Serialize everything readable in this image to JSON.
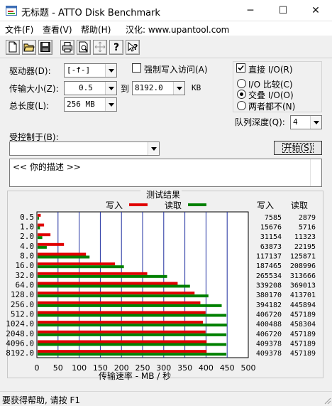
{
  "window": {
    "title": "无标题 - ATTO Disk Benchmark",
    "controls": {
      "minimize": "─",
      "maximize": "☐",
      "close": "✕"
    }
  },
  "menu": {
    "file": "文件(F)",
    "view": "查看(V)",
    "help": "帮助(H)",
    "credit": "汉化: www.upantool.com"
  },
  "toolbar": [
    "new-icon",
    "open-icon",
    "save-icon",
    "print-icon",
    "print-preview-icon",
    "move-icon",
    "help-icon",
    "context-help-icon"
  ],
  "settings": {
    "drive_label": "驱动器(D):",
    "drive_value": "[-f-]",
    "transfer_label": "传输大小(Z):",
    "transfer_from": "0.5",
    "transfer_to_label": "到",
    "transfer_to": "8192.0",
    "transfer_unit": "KB",
    "length_label": "总长度(L):",
    "length_value": "256 MB",
    "force_write_label": "强制写入访问(A)",
    "force_write_checked": false,
    "direct_io_label": "直接 I/O(R)",
    "direct_io_checked": true,
    "io_compare": "I/O 比较(C)",
    "overlapped_io": "交叠 I/O(O)",
    "neither": "两者都不(N)",
    "selected_io": "overlapped_io",
    "queue_label": "队列深度(Q):",
    "queue_value": "4",
    "controlled_by_label": "受控制于(B):",
    "controlled_by_value": "",
    "start_button": "开始(S)",
    "description": "<<  你的描述   >>"
  },
  "results": {
    "title": "测试结果",
    "legend_write": "写入",
    "legend_read": "读取",
    "col_write": "写入",
    "col_read": "读取",
    "write_color": "#e00000",
    "read_color": "#008000"
  },
  "chart_data": {
    "type": "bar",
    "title": "测试结果",
    "orientation": "horizontal",
    "xlabel": "传输速率 - MB / 秒",
    "xlim": [
      0,
      500
    ],
    "xticks": [
      0,
      50,
      100,
      150,
      200,
      250,
      300,
      350,
      400,
      450,
      500
    ],
    "grid": true,
    "legend_position": "top",
    "categories": [
      "0.5",
      "1.0",
      "2.0",
      "4.0",
      "8.0",
      "16.0",
      "32.0",
      "64.0",
      "128.0",
      "256.0",
      "512.0",
      "1024.0",
      "2048.0",
      "4096.0",
      "8192.0"
    ],
    "series": [
      {
        "name": "写入",
        "color": "#e00000",
        "values": [
          7585,
          15676,
          31154,
          63873,
          117137,
          187465,
          265534,
          339208,
          380170,
          394182,
          406720,
          400488,
          406720,
          409378,
          409378
        ]
      },
      {
        "name": "读取",
        "color": "#008000",
        "values": [
          2879,
          5716,
          11323,
          22195,
          125871,
          208996,
          313666,
          369013,
          413701,
          445894,
          457189,
          458304,
          457189,
          457189,
          457189
        ]
      }
    ]
  },
  "status": {
    "text": "要获得帮助, 请按 F1"
  }
}
